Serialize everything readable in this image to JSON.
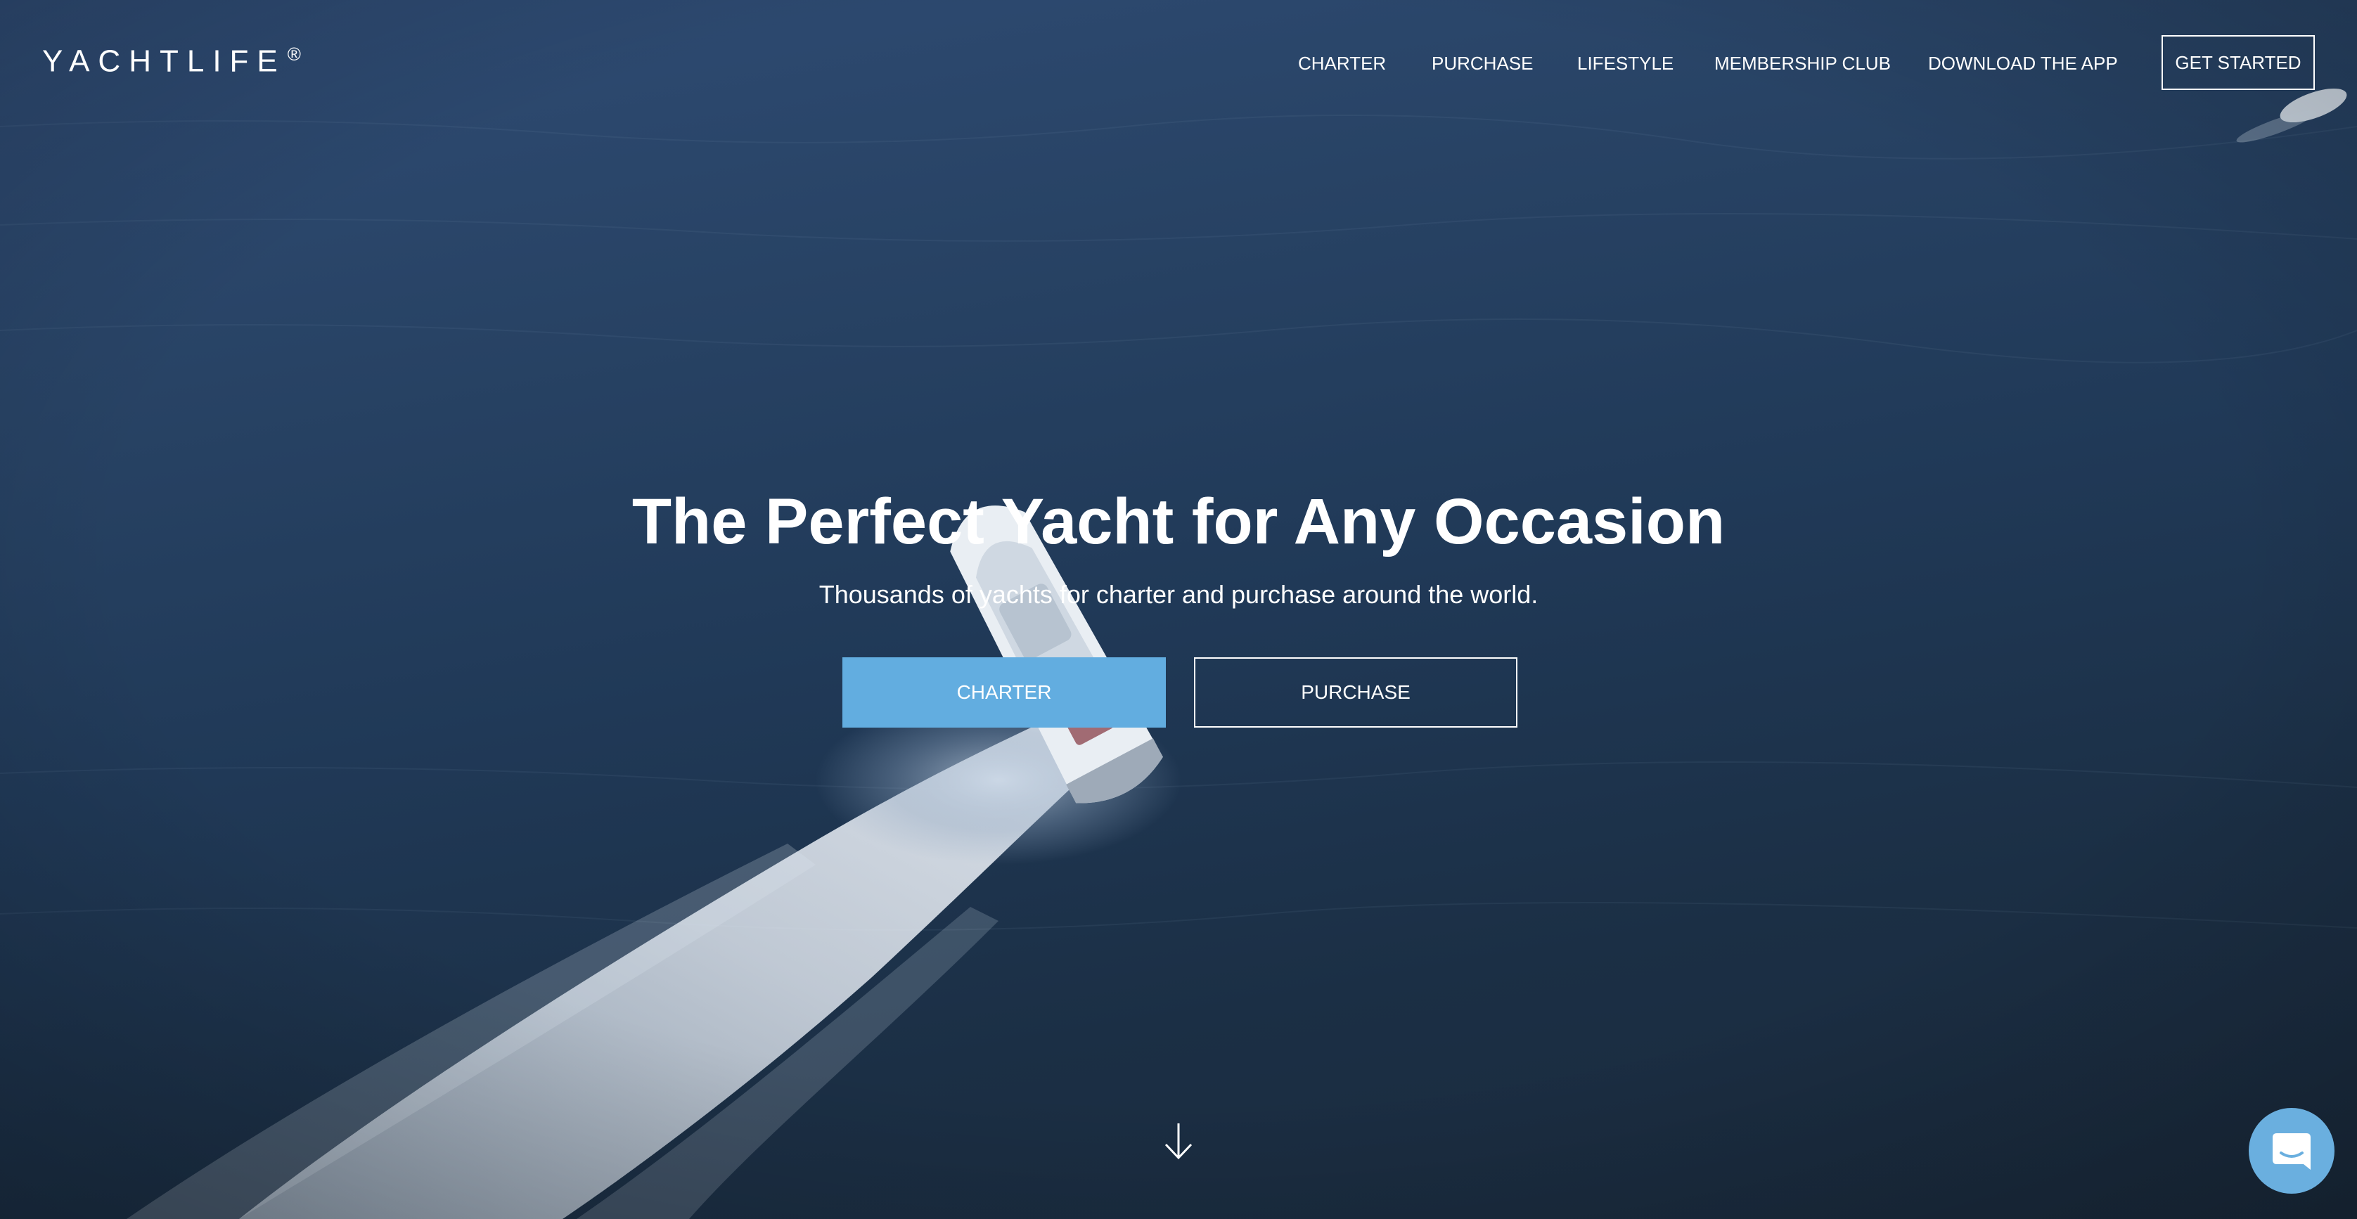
{
  "logo": {
    "text": "YACHTLIFE",
    "mark": "®"
  },
  "nav": {
    "items": [
      {
        "label": "CHARTER"
      },
      {
        "label": "PURCHASE"
      },
      {
        "label": "LIFESTYLE"
      },
      {
        "label": "MEMBERSHIP CLUB"
      },
      {
        "label": "DOWNLOAD THE APP"
      }
    ],
    "cta_label": "GET STARTED"
  },
  "hero": {
    "title": "The Perfect Yacht for Any Occasion",
    "subtitle": "Thousands of yachts for charter and purchase around the world.",
    "primary_button_label": "CHARTER",
    "secondary_button_label": "PURCHASE"
  },
  "icons": {
    "scroll": "arrow-down-icon",
    "chat": "chat-icon"
  },
  "colors": {
    "accent": "#62ade0",
    "chat": "#6aafdf",
    "sea_top": "#2f4c75",
    "sea_bottom": "#1a2a3c"
  }
}
